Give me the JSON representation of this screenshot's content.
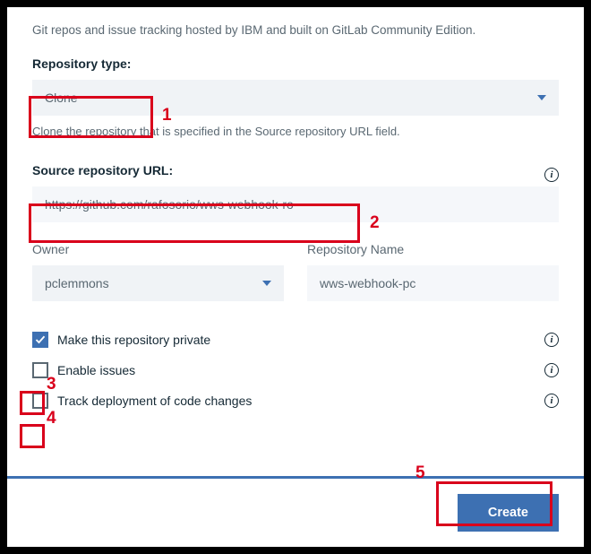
{
  "description": "Git repos and issue tracking hosted by IBM and built on GitLab Community Edition.",
  "repoType": {
    "label": "Repository type:",
    "value": "Clone",
    "helper": "Clone the repository that is specified in the Source repository URL field."
  },
  "sourceUrl": {
    "label": "Source repository URL:",
    "value": "https://github.com/rafosorio/wws-webhook-ro"
  },
  "owner": {
    "label": "Owner",
    "value": "pclemmons"
  },
  "repoName": {
    "label": "Repository Name",
    "value": "wws-webhook-pc"
  },
  "checkboxes": {
    "private": {
      "label": "Make this repository private",
      "checked": true
    },
    "issues": {
      "label": "Enable issues",
      "checked": false
    },
    "track": {
      "label": "Track deployment of code changes",
      "checked": false
    }
  },
  "footer": {
    "create": "Create"
  },
  "annotations": {
    "n1": "1",
    "n2": "2",
    "n3": "3",
    "n4": "4",
    "n5": "5"
  }
}
